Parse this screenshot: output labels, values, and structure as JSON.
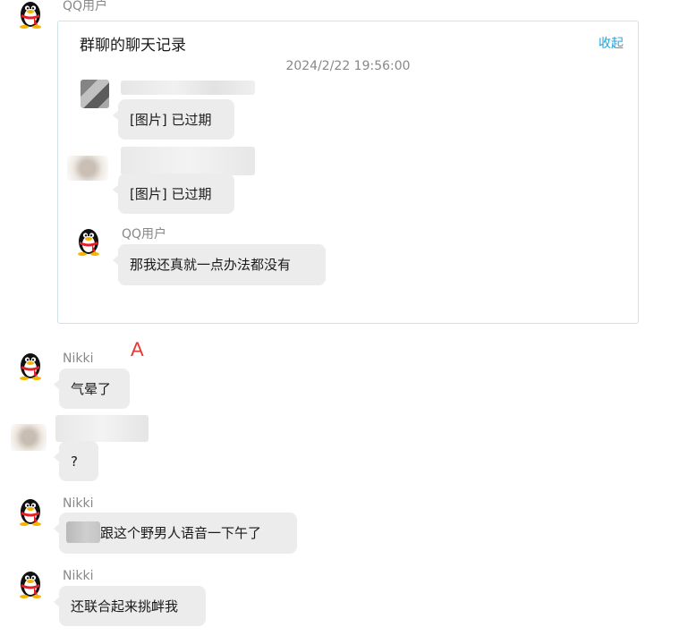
{
  "top_sender": {
    "name": "QQ用户"
  },
  "forwarded_record": {
    "title": "群聊的聊天记录",
    "collapse_label": "收起",
    "timestamp": "2024/2/22 19:56:00",
    "messages": [
      {
        "sender": "",
        "text": "[图片] 已过期",
        "avatar": "blurred-avatar"
      },
      {
        "sender": "",
        "text": "[图片] 已过期",
        "avatar": "blurred-avatar"
      },
      {
        "sender": "QQ用户",
        "text": "那我还真就一点办法都没有",
        "avatar": "qq-penguin-icon"
      }
    ]
  },
  "annotation": {
    "label": "A",
    "color": "#e53935"
  },
  "messages": [
    {
      "sender": "Nikki",
      "text": "气晕了",
      "avatar": "qq-penguin-icon"
    },
    {
      "sender": "",
      "text": "?",
      "avatar": "blurred-avatar"
    },
    {
      "sender": "Nikki",
      "text": "跟这个野男人语音一下午了",
      "avatar": "qq-penguin-icon"
    },
    {
      "sender": "Nikki",
      "text": "还联合起来挑衅我",
      "avatar": "qq-penguin-icon"
    }
  ],
  "colors": {
    "bubble": "#ececec",
    "link": "#22a3d6",
    "card_border": "#cfe2e8",
    "meta_text": "#888888"
  }
}
